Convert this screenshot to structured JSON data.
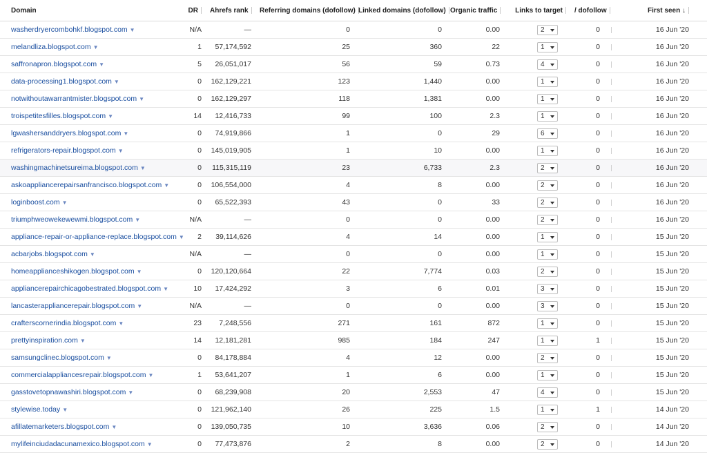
{
  "columns": {
    "domain": "Domain",
    "dr": "DR",
    "ahrefs_rank": "Ahrefs rank",
    "ref_domains": "Referring domains (dofollow)",
    "linked_domains": "Linked domains (dofollow)",
    "organic_traffic": "Organic traffic",
    "links_to_target": "Links to target",
    "dofollow": "/ dofollow",
    "first_seen": "First seen"
  },
  "sort_indicator": "↓",
  "rows": [
    {
      "domain": "washerdryercombohkf.blogspot.com",
      "dr": "N/A",
      "rank": "—",
      "ref": "0",
      "linked": "0",
      "traffic": "0.00",
      "links": "2",
      "dofollow": "0",
      "first_seen": "16 Jun '20"
    },
    {
      "domain": "melandliza.blogspot.com",
      "dr": "1",
      "rank": "57,174,592",
      "ref": "25",
      "linked": "360",
      "traffic": "22",
      "links": "1",
      "dofollow": "0",
      "first_seen": "16 Jun '20"
    },
    {
      "domain": "saffronapron.blogspot.com",
      "dr": "5",
      "rank": "26,051,017",
      "ref": "56",
      "linked": "59",
      "traffic": "0.73",
      "links": "4",
      "dofollow": "0",
      "first_seen": "16 Jun '20"
    },
    {
      "domain": "data-processing1.blogspot.com",
      "dr": "0",
      "rank": "162,129,221",
      "ref": "123",
      "linked": "1,440",
      "traffic": "0.00",
      "links": "1",
      "dofollow": "0",
      "first_seen": "16 Jun '20"
    },
    {
      "domain": "notwithoutawarrantmister.blogspot.com",
      "dr": "0",
      "rank": "162,129,297",
      "ref": "118",
      "linked": "1,381",
      "traffic": "0.00",
      "links": "1",
      "dofollow": "0",
      "first_seen": "16 Jun '20"
    },
    {
      "domain": "troispetitesfilles.blogspot.com",
      "dr": "14",
      "rank": "12,416,733",
      "ref": "99",
      "linked": "100",
      "traffic": "2.3",
      "links": "1",
      "dofollow": "0",
      "first_seen": "16 Jun '20"
    },
    {
      "domain": "lgwashersanddryers.blogspot.com",
      "dr": "0",
      "rank": "74,919,866",
      "ref": "1",
      "linked": "0",
      "traffic": "29",
      "links": "6",
      "dofollow": "0",
      "first_seen": "16 Jun '20"
    },
    {
      "domain": "refrigerators-repair.blogspot.com",
      "dr": "0",
      "rank": "145,019,905",
      "ref": "1",
      "linked": "10",
      "traffic": "0.00",
      "links": "1",
      "dofollow": "0",
      "first_seen": "16 Jun '20"
    },
    {
      "domain": "washingmachinetsureima.blogspot.com",
      "dr": "0",
      "rank": "115,315,119",
      "ref": "23",
      "linked": "6,733",
      "traffic": "2.3",
      "links": "2",
      "dofollow": "0",
      "first_seen": "16 Jun '20"
    },
    {
      "domain": "askoappliancerepairsanfrancisco.blogspot.com",
      "dr": "0",
      "rank": "106,554,000",
      "ref": "4",
      "linked": "8",
      "traffic": "0.00",
      "links": "2",
      "dofollow": "0",
      "first_seen": "16 Jun '20"
    },
    {
      "domain": "loginboost.com",
      "dr": "0",
      "rank": "65,522,393",
      "ref": "43",
      "linked": "0",
      "traffic": "33",
      "links": "2",
      "dofollow": "0",
      "first_seen": "16 Jun '20"
    },
    {
      "domain": "triumphweowekewewmi.blogspot.com",
      "dr": "N/A",
      "rank": "—",
      "ref": "0",
      "linked": "0",
      "traffic": "0.00",
      "links": "2",
      "dofollow": "0",
      "first_seen": "16 Jun '20"
    },
    {
      "domain": "appliance-repair-or-appliance-replace.blogspot.com",
      "dr": "2",
      "rank": "39,114,626",
      "ref": "4",
      "linked": "14",
      "traffic": "0.00",
      "links": "1",
      "dofollow": "0",
      "first_seen": "15 Jun '20"
    },
    {
      "domain": "acbarjobs.blogspot.com",
      "dr": "N/A",
      "rank": "—",
      "ref": "0",
      "linked": "0",
      "traffic": "0.00",
      "links": "1",
      "dofollow": "0",
      "first_seen": "15 Jun '20"
    },
    {
      "domain": "homeapplianceshikogen.blogspot.com",
      "dr": "0",
      "rank": "120,120,664",
      "ref": "22",
      "linked": "7,774",
      "traffic": "0.03",
      "links": "2",
      "dofollow": "0",
      "first_seen": "15 Jun '20"
    },
    {
      "domain": "appliancerepairchicagobestrated.blogspot.com",
      "dr": "10",
      "rank": "17,424,292",
      "ref": "3",
      "linked": "6",
      "traffic": "0.01",
      "links": "3",
      "dofollow": "0",
      "first_seen": "15 Jun '20"
    },
    {
      "domain": "lancasterappliancerepair.blogspot.com",
      "dr": "N/A",
      "rank": "—",
      "ref": "0",
      "linked": "0",
      "traffic": "0.00",
      "links": "3",
      "dofollow": "0",
      "first_seen": "15 Jun '20"
    },
    {
      "domain": "crafterscornerindia.blogspot.com",
      "dr": "23",
      "rank": "7,248,556",
      "ref": "271",
      "linked": "161",
      "traffic": "872",
      "links": "1",
      "dofollow": "0",
      "first_seen": "15 Jun '20"
    },
    {
      "domain": "prettyinspiration.com",
      "dr": "14",
      "rank": "12,181,281",
      "ref": "985",
      "linked": "184",
      "traffic": "247",
      "links": "1",
      "dofollow": "1",
      "first_seen": "15 Jun '20"
    },
    {
      "domain": "samsungclinec.blogspot.com",
      "dr": "0",
      "rank": "84,178,884",
      "ref": "4",
      "linked": "12",
      "traffic": "0.00",
      "links": "2",
      "dofollow": "0",
      "first_seen": "15 Jun '20"
    },
    {
      "domain": "commercialappliancesrepair.blogspot.com",
      "dr": "1",
      "rank": "53,641,207",
      "ref": "1",
      "linked": "6",
      "traffic": "0.00",
      "links": "1",
      "dofollow": "0",
      "first_seen": "15 Jun '20"
    },
    {
      "domain": "gasstovetopnawashiri.blogspot.com",
      "dr": "0",
      "rank": "68,239,908",
      "ref": "20",
      "linked": "2,553",
      "traffic": "47",
      "links": "4",
      "dofollow": "0",
      "first_seen": "15 Jun '20"
    },
    {
      "domain": "stylewise.today",
      "dr": "0",
      "rank": "121,962,140",
      "ref": "26",
      "linked": "225",
      "traffic": "1.5",
      "links": "1",
      "dofollow": "1",
      "first_seen": "14 Jun '20"
    },
    {
      "domain": "afillatemarketers.blogspot.com",
      "dr": "0",
      "rank": "139,050,735",
      "ref": "10",
      "linked": "3,636",
      "traffic": "0.06",
      "links": "2",
      "dofollow": "0",
      "first_seen": "14 Jun '20"
    },
    {
      "domain": "mylifeinciudadacunamexico.blogspot.com",
      "dr": "0",
      "rank": "77,473,876",
      "ref": "2",
      "linked": "8",
      "traffic": "0.00",
      "links": "2",
      "dofollow": "0",
      "first_seen": "14 Jun '20"
    }
  ]
}
